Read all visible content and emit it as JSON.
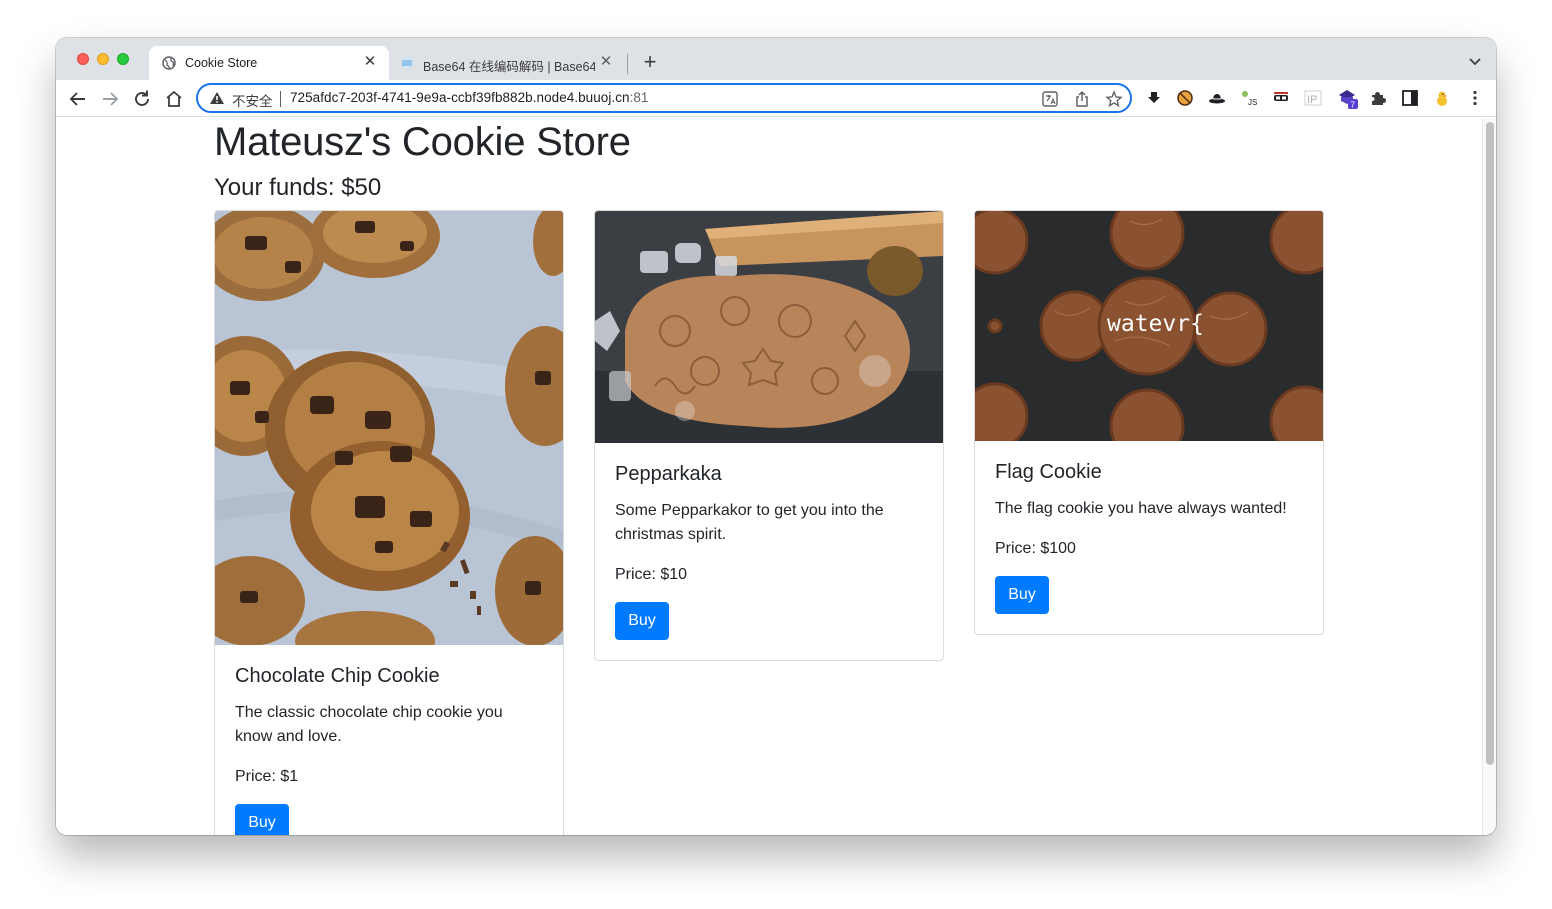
{
  "browser": {
    "tabs": [
      {
        "title": "Cookie Store",
        "active": true
      },
      {
        "title": "Base64 在线编码解码 | Base64",
        "active": false
      }
    ],
    "address": {
      "security_label": "不安全",
      "url_host": "725afdc7-203f-4741-9e9a-ccbf39fb882b.node4.buuoj.cn",
      "url_port": ":81"
    },
    "extensions": [
      "download-icon",
      "pizza-icon",
      "hat-icon",
      "js-icon",
      "mask-icon",
      "ip-icon",
      "badge-extension-icon",
      "puzzle-icon",
      "sidepanel-icon",
      "chick-icon",
      "kebab-menu-icon"
    ],
    "extension_badge": "7",
    "ip_label": "IP",
    "accent": "#1a73e8"
  },
  "page": {
    "title": "Mateusz's Cookie Store",
    "funds": "Your funds: $50",
    "cards": [
      {
        "title": "Chocolate Chip Cookie",
        "text": "The classic chocolate chip cookie you know and love.",
        "price": "Price: $1",
        "button": "Buy"
      },
      {
        "title": "Pepparkaka",
        "text": "Some Pepparkakor to get you into the christmas spirit.",
        "price": "Price: $10",
        "button": "Buy"
      },
      {
        "title": "Flag Cookie",
        "text": "The flag cookie you have always wanted!",
        "price": "Price: $100",
        "button": "Buy",
        "image_overlay_text": "watevr{"
      }
    ],
    "button_color": "#007bff"
  }
}
